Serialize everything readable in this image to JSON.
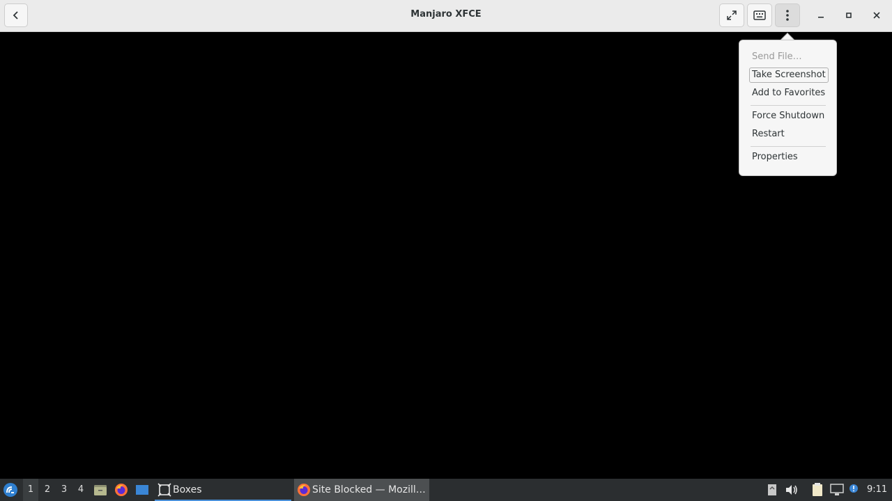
{
  "window": {
    "title": "Manjaro XFCE"
  },
  "menu": {
    "items": [
      {
        "label": "Send File…",
        "enabled": false
      },
      {
        "label": "Take Screenshot",
        "enabled": true
      },
      {
        "label": "Add to Favorites",
        "enabled": true
      },
      {
        "label": "Force Shutdown",
        "enabled": true
      },
      {
        "label": "Restart",
        "enabled": true
      },
      {
        "label": "Properties",
        "enabled": true
      }
    ]
  },
  "taskbar": {
    "workspaces": [
      "1",
      "2",
      "3",
      "4"
    ],
    "active_workspace": "1",
    "tasks": [
      {
        "label": "Boxes",
        "icon": "boxes-icon"
      },
      {
        "label": "Site Blocked — Mozill…",
        "icon": "firefox-icon"
      }
    ],
    "clock": "9:11"
  },
  "colors": {
    "headerbar": "#ebebeb",
    "panel": "#2b2e30",
    "accent": "#4a90d9",
    "vm_display": "#000000"
  }
}
